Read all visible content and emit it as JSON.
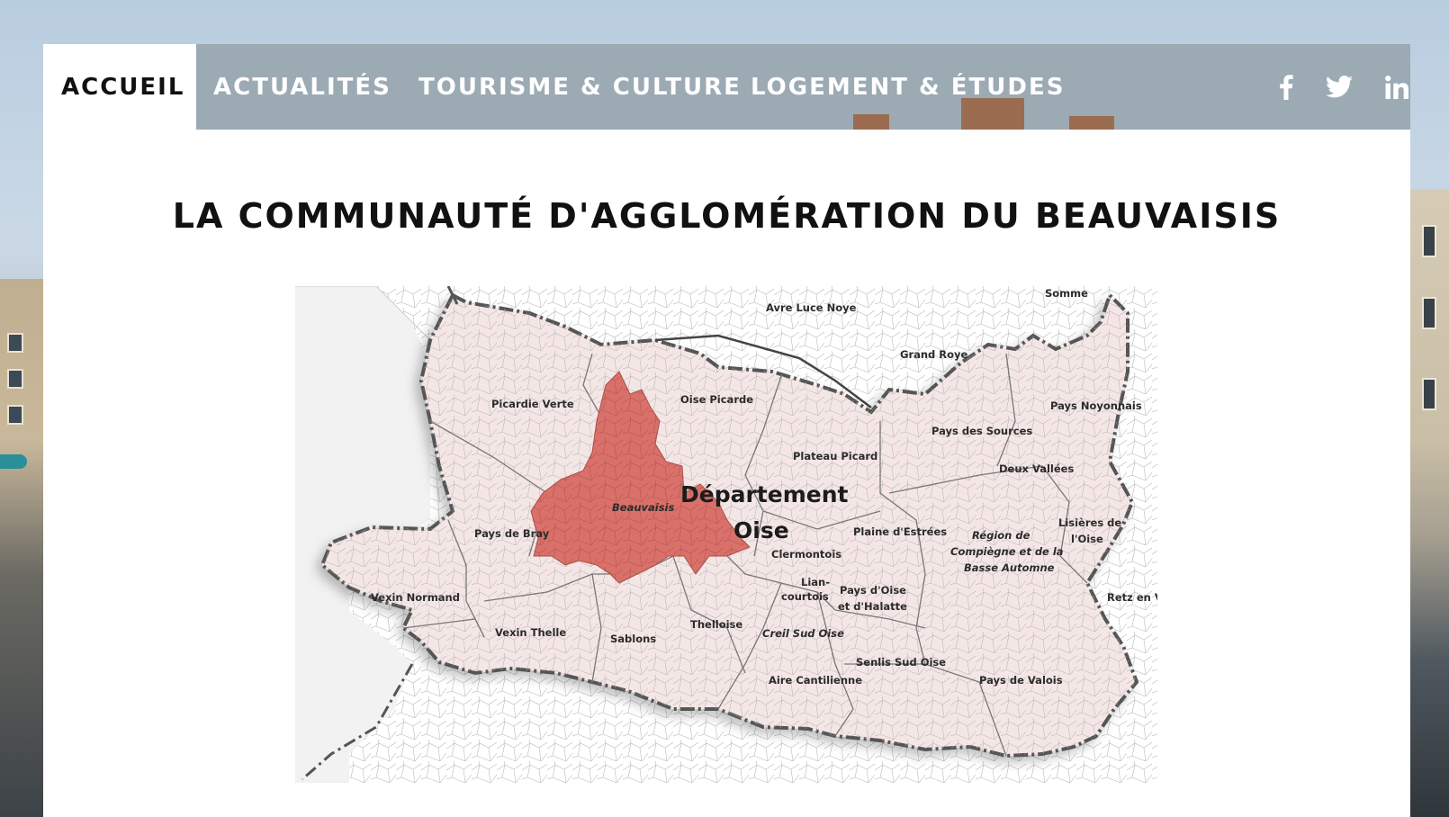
{
  "nav": {
    "items": [
      {
        "label": "ACCUEIL",
        "active": true
      },
      {
        "label": "ACTUALITÉS",
        "active": false
      },
      {
        "label": "TOURISME & CULTURE",
        "active": false
      },
      {
        "label": "LOGEMENT & ÉTUDES",
        "active": false
      }
    ],
    "social": [
      "facebook-icon",
      "twitter-icon",
      "linkedin-icon"
    ]
  },
  "page": {
    "title": "LA COMMUNAUTÉ D'AGGLOMÉRATION DU BEAUVAISIS"
  },
  "map": {
    "department_line1": "Département",
    "department_line2": "Oise",
    "highlight_color": "#d9706a",
    "region_color": "#f5e6e6",
    "regions": {
      "avre_luce_noye": "Avre Luce Noye",
      "somme": "Somme",
      "grand_roye": "Grand Roye",
      "picardie_verte": "Picardie Verte",
      "oise_picarde": "Oise Picarde",
      "pays_noyonnais": "Pays Noyonnais",
      "pays_des_sources": "Pays des Sources",
      "plateau_picard": "Plateau Picard",
      "deux_vallees": "Deux Vallées",
      "beauvaisis": "Beauvaisis",
      "pays_de_bray": "Pays de Bray",
      "plaine_d_estrees": "Plaine d'Estrées",
      "region_de": "Région de",
      "compiegne": "Compiègne et de la",
      "basse_automne": "Basse Automne",
      "lisieres_1": "Lisières de",
      "lisieres_2": "l'Oise",
      "clermontois": "Clermontois",
      "liancourtois_1": "Lian-",
      "liancourtois_2": "courtois",
      "pays_d_oise_1": "Pays d'Oise",
      "pays_d_oise_2": "et d'Halatte",
      "retz_en_valois": "Retz en Val",
      "vexin_normand": "Vexin Normand",
      "vexin_thelle": "Vexin Thelle",
      "sablons": "Sablons",
      "thelloise": "Thelloise",
      "creil_sud_oise": "Creil Sud Oise",
      "senlis_sud_oise": "Senlis Sud Oise",
      "pays_de_valois": "Pays de Valois",
      "aire_cantilienne": "Aire Cantilienne"
    }
  }
}
